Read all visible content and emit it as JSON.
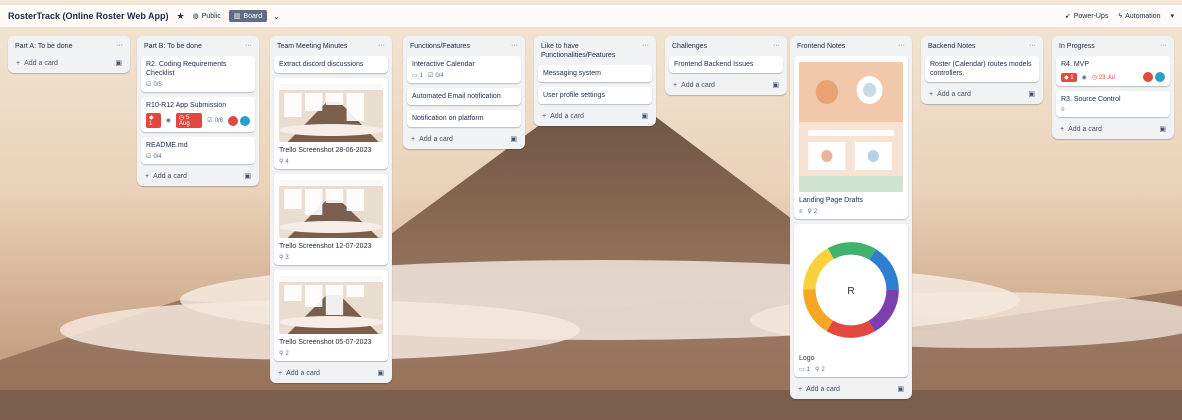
{
  "board": {
    "title": "RosterTrack (Online Roster Web App)",
    "star_icon": "star-icon",
    "visibility": "Public",
    "view_label": "Board",
    "powerups_label": "Power-Ups",
    "automation_label": "Automation"
  },
  "add_card_label": "Add a card",
  "lists": [
    {
      "title": "Part A: To be done",
      "cards": []
    },
    {
      "title": "Part B: To be done",
      "cards": [
        {
          "title": "R2. Coding Requirements Checklist",
          "checklist": "0/5"
        },
        {
          "title": "R10-R12 App Submission",
          "label": "1",
          "due": "5 Aug",
          "checklist": "0/6"
        },
        {
          "title": "README.md",
          "checklist": "0/4"
        }
      ]
    },
    {
      "title": "Team Meeting Minutes",
      "cards": [
        {
          "title": "Extract discord discussions"
        },
        {
          "title": "Trello Screenshot 28-06-2023",
          "attachments": "4"
        },
        {
          "title": "Trello Screenshot 12-07-2023",
          "attachments": "3"
        },
        {
          "title": "Trello Screenshot 05-07-2023",
          "attachments": "2"
        }
      ]
    },
    {
      "title": "Functions/Features",
      "cards": [
        {
          "title": "Interactive Calendar",
          "comments": "1",
          "checklist": "0/4"
        },
        {
          "title": "Automated Email notification"
        },
        {
          "title": "Notification on platform"
        }
      ]
    },
    {
      "title": "Like to have Functionalities/Features",
      "cards": [
        {
          "title": "Messaging system"
        },
        {
          "title": "User profile settings"
        }
      ]
    },
    {
      "title": "Challenges",
      "cards": [
        {
          "title": "Frontend Backend Issues"
        }
      ]
    },
    {
      "title": "Frontend Notes",
      "cards": [
        {
          "title": "Landing Page Drafts",
          "attachments": "2"
        },
        {
          "title": "Logo",
          "comments": "1",
          "attachments": "2",
          "logo_letter": "R"
        }
      ]
    },
    {
      "title": "Backend Notes",
      "cards": [
        {
          "title": "Roster (Calendar) routes models controllers."
        }
      ]
    },
    {
      "title": "In Progress",
      "cards": [
        {
          "title": "R4. MVP",
          "label": "1",
          "due": "23 Jul"
        },
        {
          "title": "R3. Source Control"
        }
      ]
    }
  ],
  "colors": {
    "label_red": "#e2483d",
    "avatar_blue": "#29a0c6",
    "list_bg": "#f1f2f4"
  }
}
